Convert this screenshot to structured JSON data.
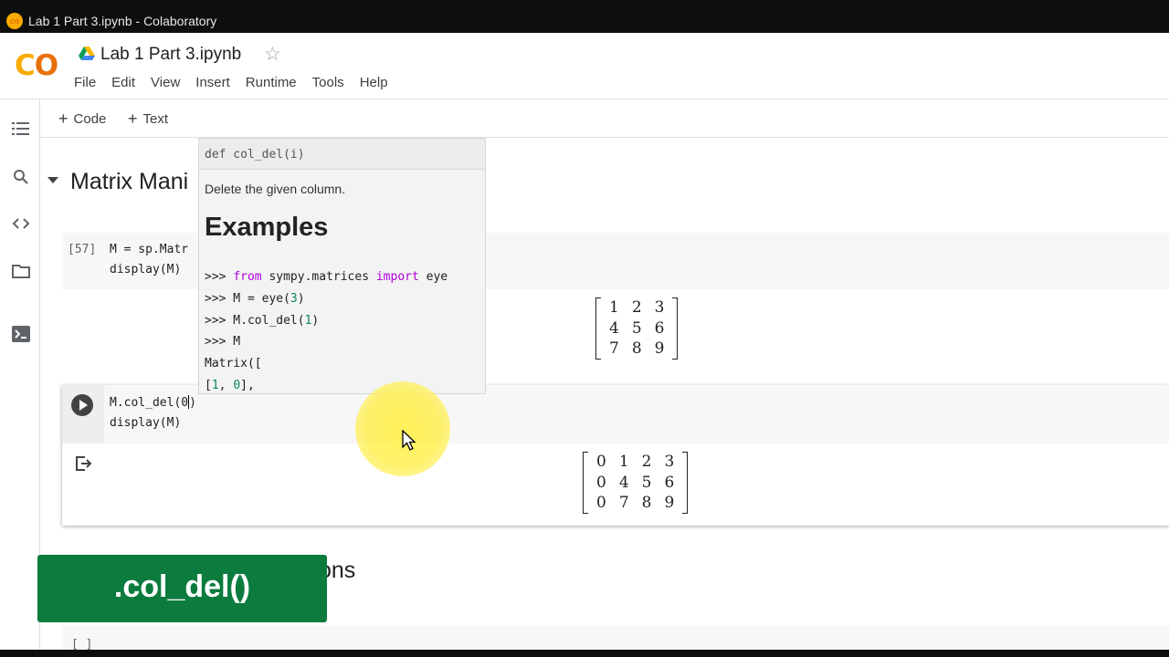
{
  "window": {
    "title": "Lab 1 Part 3.ipynb - Colaboratory"
  },
  "header": {
    "logo_text": "CO",
    "notebook_title": "Lab 1 Part 3.ipynb",
    "menu": [
      "File",
      "Edit",
      "View",
      "Insert",
      "Runtime",
      "Tools",
      "Help"
    ]
  },
  "toolbar": {
    "add_code": "Code",
    "add_text": "Text"
  },
  "sidebar": {
    "icons": [
      "table-of-contents-icon",
      "search-icon",
      "code-snippets-icon",
      "files-icon",
      "terminal-icon"
    ]
  },
  "section1": {
    "heading": "Matrix Mani"
  },
  "cell1": {
    "prompt": "[57]",
    "lines": [
      "M = sp.Matr",
      "display(M)"
    ],
    "output_matrix": [
      [
        "1",
        "2",
        "3"
      ],
      [
        "4",
        "5",
        "6"
      ],
      [
        "7",
        "8",
        "9"
      ]
    ]
  },
  "tooltip": {
    "signature": "def col_del(i)",
    "description": "Delete the given column.",
    "examples_heading": "Examples",
    "doc_lines": [
      [
        {
          "t": ">>> "
        },
        {
          "t": "from",
          "c": "kw"
        },
        {
          "t": " sympy.matrices "
        },
        {
          "t": "import",
          "c": "kw"
        },
        {
          "t": " eye"
        }
      ],
      [
        {
          "t": ">>> M = eye("
        },
        {
          "t": "3",
          "c": "num"
        },
        {
          "t": ")"
        }
      ],
      [
        {
          "t": ">>> M.col_del("
        },
        {
          "t": "1",
          "c": "num"
        },
        {
          "t": ")"
        }
      ],
      [
        {
          "t": ">>> M"
        }
      ],
      [
        {
          "t": "Matrix(["
        }
      ],
      [
        {
          "t": "["
        },
        {
          "t": "1",
          "c": "num"
        },
        {
          "t": ", "
        },
        {
          "t": "0",
          "c": "num"
        },
        {
          "t": "],"
        }
      ]
    ]
  },
  "cell2": {
    "line1_before_cursor": "M.col_del(0",
    "line1_after_cursor": ")",
    "line2": "display(M)",
    "output_matrix": [
      [
        "0",
        "1",
        "2",
        "3"
      ],
      [
        "0",
        "4",
        "5",
        "6"
      ],
      [
        "0",
        "7",
        "8",
        "9"
      ]
    ]
  },
  "section2": {
    "heading_fragment": "ons"
  },
  "banner": {
    "text": ".col_del()"
  },
  "cell3": {
    "prompt": "[ ]"
  },
  "colors": {
    "banner": "#0b7b3e",
    "colab_orange": "#f9ab00",
    "colab_dark_orange": "#e8710a",
    "keyword": "#af00db",
    "number": "#098658"
  }
}
